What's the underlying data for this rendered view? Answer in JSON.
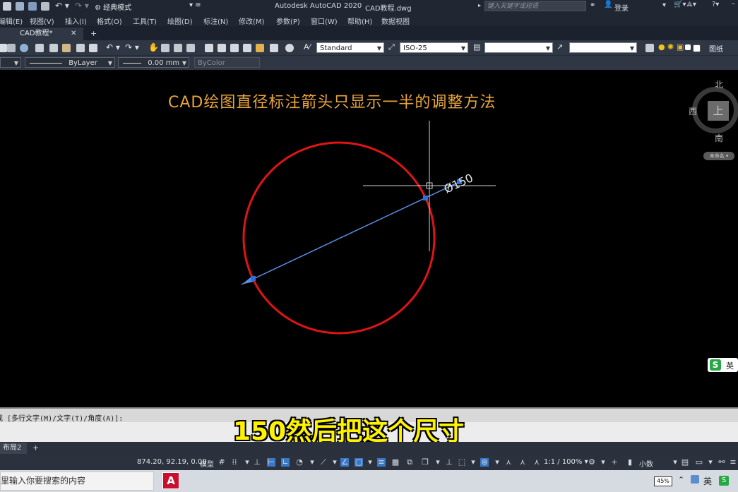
{
  "titlebar": {
    "workspace": "经典模式",
    "app_title": "Autodesk AutoCAD 2020",
    "doc_title": "CAD教程.dwg",
    "search_placeholder": "键入关键字或短语",
    "login": "登录"
  },
  "menubar": {
    "items": [
      "编辑(E)",
      "视图(V)",
      "插入(I)",
      "格式(O)",
      "工具(T)",
      "绘图(D)",
      "标注(N)",
      "修改(M)",
      "参数(P)",
      "窗口(W)",
      "帮助(H)",
      "数据视图"
    ]
  },
  "tabs": {
    "active": "CAD教程*",
    "close": "✕",
    "add": "+"
  },
  "toolbar1": {
    "text_style": "Standard",
    "dim_style": "ISO-25",
    "table_style": "",
    "multileader_style": "",
    "layer_label": "图纸"
  },
  "toolbar2": {
    "color": "",
    "linetype": "ByLayer",
    "lineweight": "0.00 mm",
    "plotstyle": "ByColor"
  },
  "drawing": {
    "heading": "CAD绘图直径标注箭头只显示一半的调整方法",
    "dim_text": "Ø150",
    "circle_color": "#e01414",
    "dim_color": "#5b8fe6"
  },
  "viewcube": {
    "north": "北",
    "south": "南",
    "west": "西",
    "top": "上",
    "wcs": "未命名"
  },
  "ime_badge": {
    "logo": "S",
    "label": "英"
  },
  "command": {
    "prompt": "或 [多行文字(M)/文字(T)/角度(A)]:",
    "subtitle": "150然后把这个尺寸"
  },
  "layout_tabs": {
    "layout": "布局2",
    "add": "+"
  },
  "statusbar": {
    "coords": "874.20, 92.19, 0.00",
    "model": "模型",
    "scale": "1:1 / 100%",
    "units": "小数"
  },
  "taskbar": {
    "search": "里输入你要搜索的内容",
    "battery": "45%",
    "ime": "英"
  }
}
